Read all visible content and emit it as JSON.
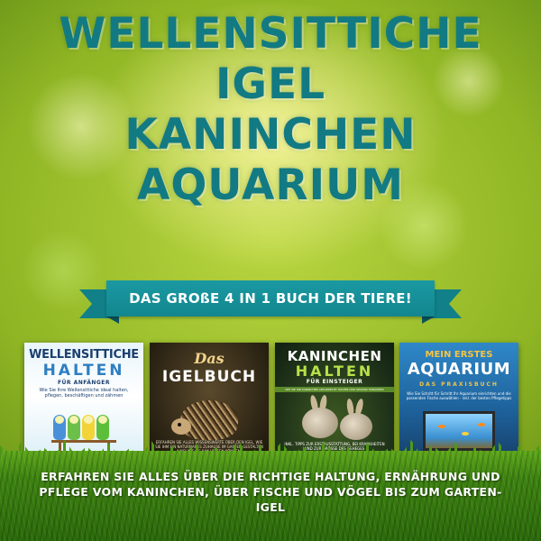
{
  "title_lines": [
    "WELLENSITTICHE",
    "IGEL",
    "KANINCHEN",
    "AQUARIUM"
  ],
  "banner_text": "DAS GROßE 4 IN 1 BUCH DER TIERE!",
  "books": [
    {
      "title_top": "WELLENSITTICHE",
      "title_main": "HALTEN",
      "subtitle": "FÜR ANFÄNGER",
      "description": "Wie Sie Ihre Wellensittiche ideal halten, pflegen, beschäftigen und zähmen",
      "footer": "INKL. NOTFALLPLAN BEI KRANKHEIT UND FUTTERTIPPS"
    },
    {
      "title_top": "Das",
      "title_main": "IGELBUCH",
      "description": "ERFAHREN SIE ALLES WISSENSWERTE ÜBER DEN IGEL, WIE SIE IHM EIN NATURNAHES ZUHAUSE IM GARTEN GESTALTEN UND WIE SIE IHM HELFEN KÖNNEN"
    },
    {
      "title_top": "KANINCHEN",
      "title_main": "HALTEN",
      "subtitle": "FÜR EINSTEIGER",
      "strip": "WIE SIE IHR KANINCHEN ARTGERECHT HALTEN UND GESUND ERNÄHREN",
      "description": "INKL. TIPPS ZUR ERSTAUSSTATTUNG, BEI KRANKHEITEN UND ZUR GRÖSSE DES GEHEGES"
    },
    {
      "title_top": "MEIN ERSTES",
      "title_main": "AQUARIUM",
      "subtitle": "DAS PRAXISBUCH",
      "description": "Wie Sie Schritt für Schritt Ihr Aquarium einrichten und die passenden Fische auswählen - inkl. der besten Pflegetipps"
    }
  ],
  "bottom_text": "ERFAHREN SIE ALLES ÜBER DIE RICHTIGE HALTUNG, ERNÄHRUNG UND PFLEGE VOM KANINCHEN, ÜBER FISCHE UND VÖGEL BIS ZUM GARTEN-IGEL",
  "colors": {
    "title": "#127a82",
    "banner": "#1a99a2",
    "background_light": "#f4f39a",
    "background_dark": "#2f5a08",
    "grass": "#3e8410"
  }
}
